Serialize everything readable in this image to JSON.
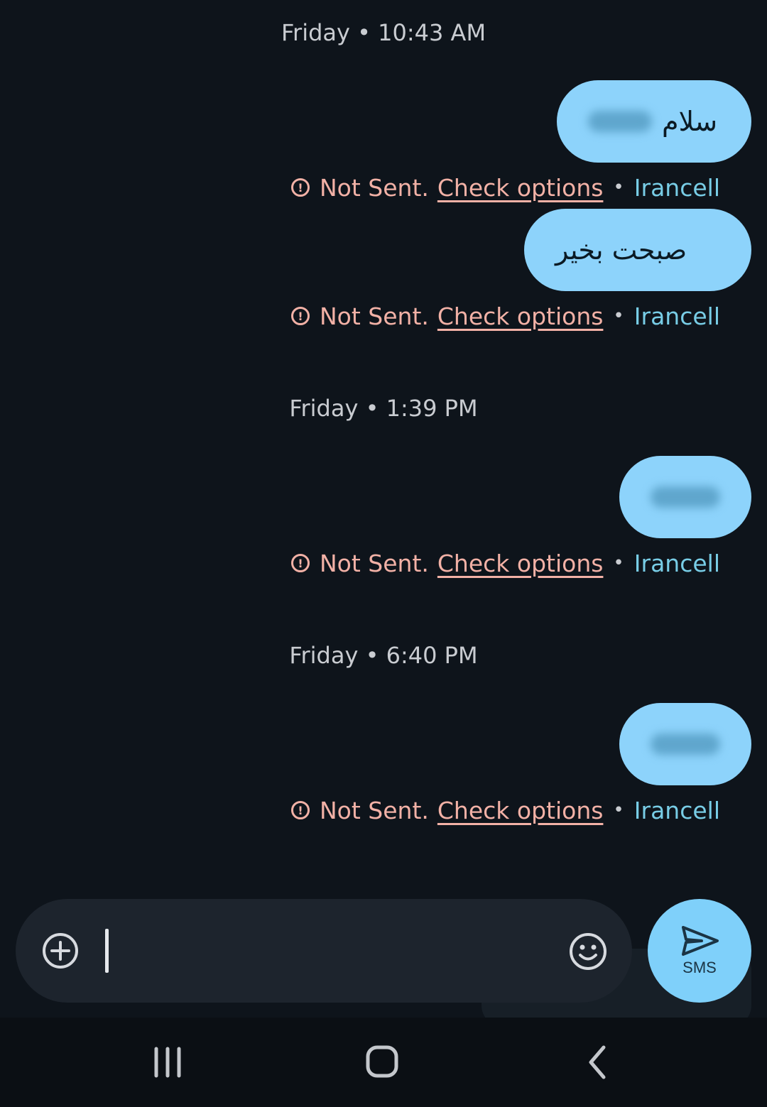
{
  "conversation": {
    "groups": [
      {
        "timestamp": "Friday • 10:43 AM",
        "messages": [
          {
            "text": "سلام",
            "redacted_part": true,
            "status": "Not Sent.",
            "action": "Check options",
            "carrier": "Irancell"
          },
          {
            "text": "صبحت بخیر",
            "redacted_part": false,
            "status": "Not Sent.",
            "action": "Check options",
            "carrier": "Irancell"
          }
        ]
      },
      {
        "timestamp": "Friday • 1:39 PM",
        "messages": [
          {
            "text": "",
            "redacted_part": true,
            "status": "Not Sent.",
            "action": "Check options",
            "carrier": "Irancell"
          }
        ]
      },
      {
        "timestamp": "Friday • 6:40 PM",
        "messages": [
          {
            "text": "",
            "redacted_part": true,
            "status": "Not Sent.",
            "action": "Check options",
            "carrier": "Irancell"
          }
        ]
      }
    ],
    "separator": "•"
  },
  "compose": {
    "placeholder": "",
    "value": ""
  },
  "send_button": {
    "label": "SMS"
  },
  "colors": {
    "background": "#0e141b",
    "bubble": "#8dd3fb",
    "error": "#f2b1a6",
    "carrier": "#78cde6",
    "send": "#7fd0fa"
  },
  "icons": {
    "alert": "alert-circle-icon",
    "add": "add-circle-icon",
    "emoji": "emoji-icon",
    "send": "send-icon",
    "recents": "recents-icon",
    "home": "home-icon",
    "back": "back-icon"
  }
}
